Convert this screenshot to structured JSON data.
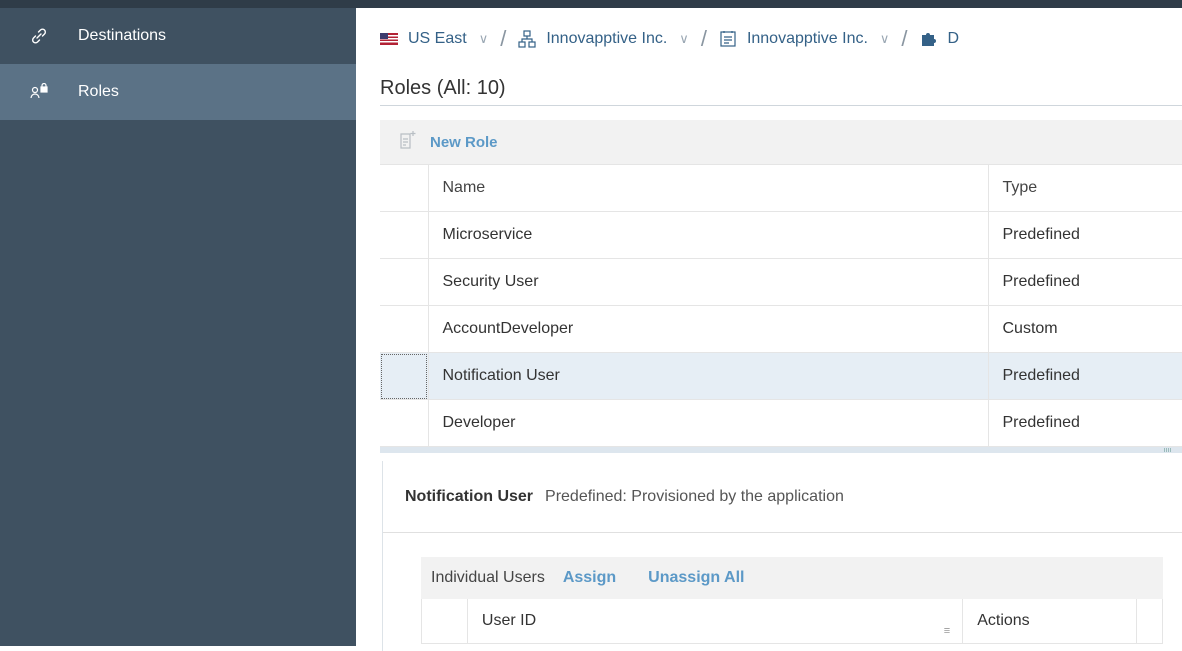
{
  "sidebar": {
    "items": [
      {
        "label": "Destinations",
        "icon": "link-icon"
      },
      {
        "label": "Roles",
        "icon": "roles-icon"
      }
    ]
  },
  "breadcrumb": {
    "region": "US East",
    "global_account": "Innovapptive Inc.",
    "subaccount": "Innovapptive Inc.",
    "app_truncated": "D"
  },
  "page": {
    "title": "Roles (All: 10)",
    "new_role_label": "New Role"
  },
  "roles_table": {
    "headers": {
      "name": "Name",
      "type": "Type"
    },
    "rows": [
      {
        "name": "Microservice",
        "type": "Predefined"
      },
      {
        "name": "Security User",
        "type": "Predefined"
      },
      {
        "name": "AccountDeveloper",
        "type": "Custom"
      },
      {
        "name": "Notification User",
        "type": "Predefined"
      },
      {
        "name": "Developer",
        "type": "Predefined"
      }
    ],
    "selected_index": 3
  },
  "details": {
    "name": "Notification User",
    "description": "Predefined: Provisioned by the application",
    "users_label": "Individual Users",
    "assign_label": "Assign",
    "unassign_all_label": "Unassign All",
    "headers": {
      "user_id": "User ID",
      "actions": "Actions"
    }
  },
  "colors": {
    "sidebar_bg": "#3f5161",
    "sidebar_active": "#5b7286",
    "link": "#5c99c7",
    "breadcrumb_text": "#346187",
    "selected_row": "#e6eef5"
  }
}
